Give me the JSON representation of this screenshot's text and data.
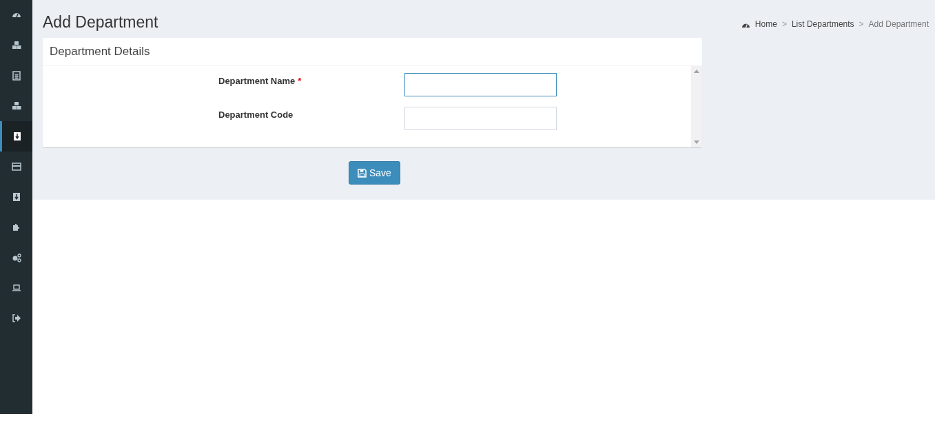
{
  "sidebar": {
    "items": [
      {
        "kind": "gauge",
        "selected": false
      },
      {
        "kind": "cubes",
        "selected": false
      },
      {
        "kind": "calculator",
        "selected": false
      },
      {
        "kind": "cubes",
        "selected": false
      },
      {
        "kind": "download",
        "selected": true
      },
      {
        "kind": "card",
        "selected": false
      },
      {
        "kind": "download",
        "selected": false
      },
      {
        "kind": "puzzle",
        "selected": false
      },
      {
        "kind": "gears",
        "selected": false
      },
      {
        "kind": "laptop",
        "selected": false
      },
      {
        "kind": "signout",
        "selected": false
      }
    ]
  },
  "page_title": "Add Department",
  "breadcrumb": [
    {
      "label": "Home",
      "current": false
    },
    {
      "label": "List Departments",
      "current": false
    },
    {
      "label": "Add Department",
      "current": true
    }
  ],
  "breadcrumb_separator": ">",
  "panel": {
    "title": "Department Details",
    "fields": [
      {
        "label": "Department Name",
        "required_mark": "*",
        "focused": true
      },
      {
        "label": "Department Code",
        "focused": false
      }
    ]
  },
  "save_button": {
    "label": "Save"
  }
}
